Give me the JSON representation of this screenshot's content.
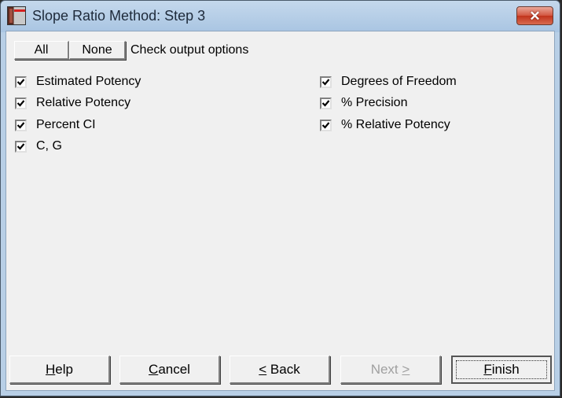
{
  "window": {
    "title": "Slope Ratio Method: Step 3",
    "close_icon": "close-x-icon"
  },
  "toolbar": {
    "all_label": "All",
    "none_label": "None",
    "hint": "Check output options"
  },
  "options": {
    "left": [
      {
        "label": "Estimated Potency",
        "checked": true
      },
      {
        "label": "Relative Potency",
        "checked": true
      },
      {
        "label": "Percent CI",
        "checked": true
      },
      {
        "label": "C, G",
        "checked": true
      }
    ],
    "right": [
      {
        "label": "Degrees of Freedom",
        "checked": true
      },
      {
        "label": "% Precision",
        "checked": true
      },
      {
        "label": "% Relative Potency",
        "checked": true
      }
    ]
  },
  "buttons": {
    "help": {
      "mnemonic": "H",
      "rest": "elp"
    },
    "cancel": {
      "mnemonic": "C",
      "rest": "ancel"
    },
    "back": {
      "mnemonic": "<",
      "rest": " Back"
    },
    "next": {
      "pre": "Next ",
      "mnemonic": ">",
      "disabled": true
    },
    "finish": {
      "mnemonic": "F",
      "rest": "inish",
      "default": true
    }
  }
}
